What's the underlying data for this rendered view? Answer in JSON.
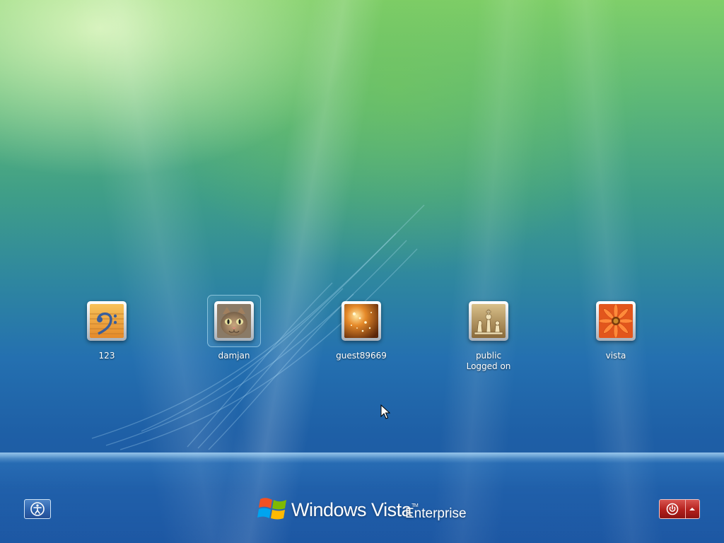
{
  "users": [
    {
      "name": "123",
      "status": "",
      "picture": "bass-clef-icon",
      "selected": false
    },
    {
      "name": "damjan",
      "status": "",
      "picture": "kitten-icon",
      "selected": true
    },
    {
      "name": "guest89669",
      "status": "",
      "picture": "sparkles-icon",
      "selected": false
    },
    {
      "name": "public",
      "status": "Logged on",
      "picture": "chess-pieces-icon",
      "selected": false
    },
    {
      "name": "vista",
      "status": "",
      "picture": "orange-flower-icon",
      "selected": false
    }
  ],
  "logo": {
    "windows": "Windows",
    "vista": "Vista",
    "tm": "TM",
    "edition": "Enterprise"
  },
  "buttons": {
    "ease_of_access": "ease-of-access-icon",
    "shutdown": "power-icon",
    "shutdown_options": "up-arrow-icon"
  },
  "colors": {
    "power_red": "#b3201c",
    "ease_blue": "#2d62ad"
  }
}
